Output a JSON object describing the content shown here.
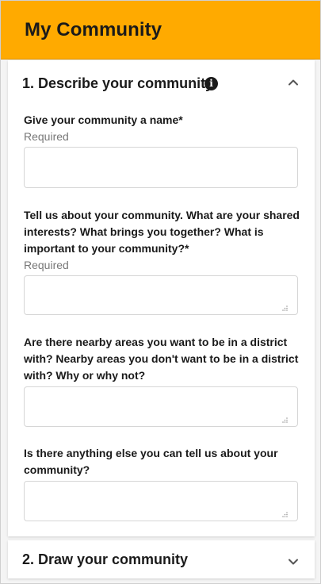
{
  "header": {
    "title": "My Community"
  },
  "section1": {
    "title": "1. Describe your community",
    "info_icon_glyph": "i",
    "fields": [
      {
        "label": "Give your community a name*",
        "hint": "Required",
        "value": ""
      },
      {
        "label": "Tell us about your community. What are your shared interests? What brings you together? What is important to your community?*",
        "hint": "Required",
        "value": ""
      },
      {
        "label": "Are there nearby areas you want to be in a district with? Nearby areas you don't want to be in a district with? Why or why not?",
        "value": ""
      },
      {
        "label": "Is there anything else you can tell us about your community?",
        "value": ""
      }
    ]
  },
  "section2": {
    "title": "2. Draw your community"
  },
  "colors": {
    "header_bg": "#ffaa00",
    "text": "#1a1a1a",
    "hint": "#777777",
    "field_border": "#d6d6d6"
  },
  "icons": {
    "info": "info-icon",
    "collapse": "chevron-up-icon",
    "expand": "chevron-down-icon",
    "resize": "resize-grip-icon"
  }
}
